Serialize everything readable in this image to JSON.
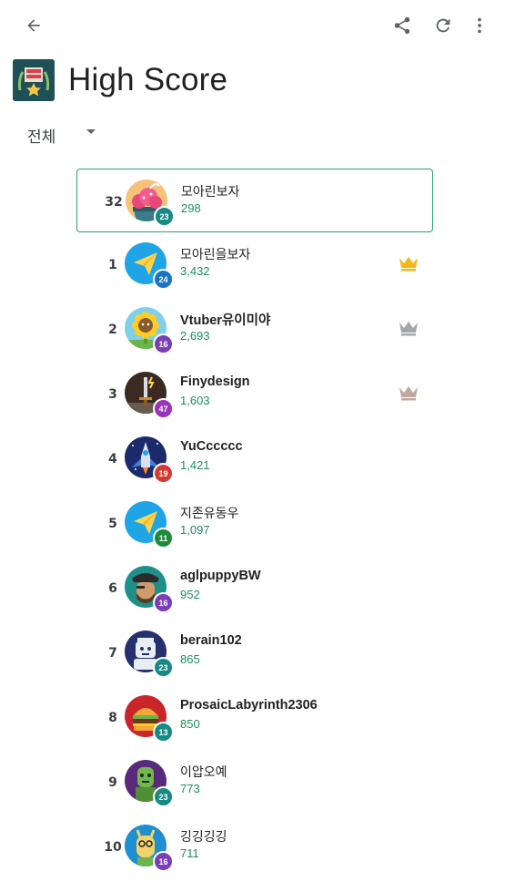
{
  "header": {
    "title": "High Score"
  },
  "filter": {
    "label": "전체"
  },
  "icons": {
    "back": "arrow-back-icon",
    "share": "share-icon",
    "refresh": "refresh-icon",
    "more": "more-vert-icon",
    "crown_gold": "#f5b81a",
    "crown_silver": "#a3a6ab",
    "crown_bronze": "#c2a79f"
  },
  "player": {
    "rank": "32",
    "name": "모아린보자",
    "score": "298",
    "level": "23",
    "level_color": "#178a85"
  },
  "leaderboard": [
    {
      "rank": "1",
      "name": "모아린을보자",
      "score": "3,432",
      "level": "24",
      "level_color": "#1a73c7"
    },
    {
      "rank": "2",
      "name": "Vtuber유이미야",
      "score": "2,693",
      "level": "16",
      "level_color": "#7b3fb5"
    },
    {
      "rank": "3",
      "name": "Finydesign",
      "score": "1,603",
      "level": "47",
      "level_color": "#9a33b8"
    },
    {
      "rank": "4",
      "name": "YuCccccc",
      "score": "1,421",
      "level": "19",
      "level_color": "#d23b2f"
    },
    {
      "rank": "5",
      "name": "지존유동우",
      "score": "1,097",
      "level": "11",
      "level_color": "#1e8a3c"
    },
    {
      "rank": "6",
      "name": "aglpuppyBW",
      "score": "952",
      "level": "16",
      "level_color": "#7b3fb5"
    },
    {
      "rank": "7",
      "name": "berain102",
      "score": "865",
      "level": "23",
      "level_color": "#178a85"
    },
    {
      "rank": "8",
      "name": "ProsaicLabyrinth2306",
      "score": "850",
      "level": "13",
      "level_color": "#178a85"
    },
    {
      "rank": "9",
      "name": "이압오예",
      "score": "773",
      "level": "23",
      "level_color": "#178a85"
    },
    {
      "rank": "10",
      "name": "깅깅깅깅",
      "score": "711",
      "level": "16",
      "level_color": "#7b3fb5"
    }
  ]
}
